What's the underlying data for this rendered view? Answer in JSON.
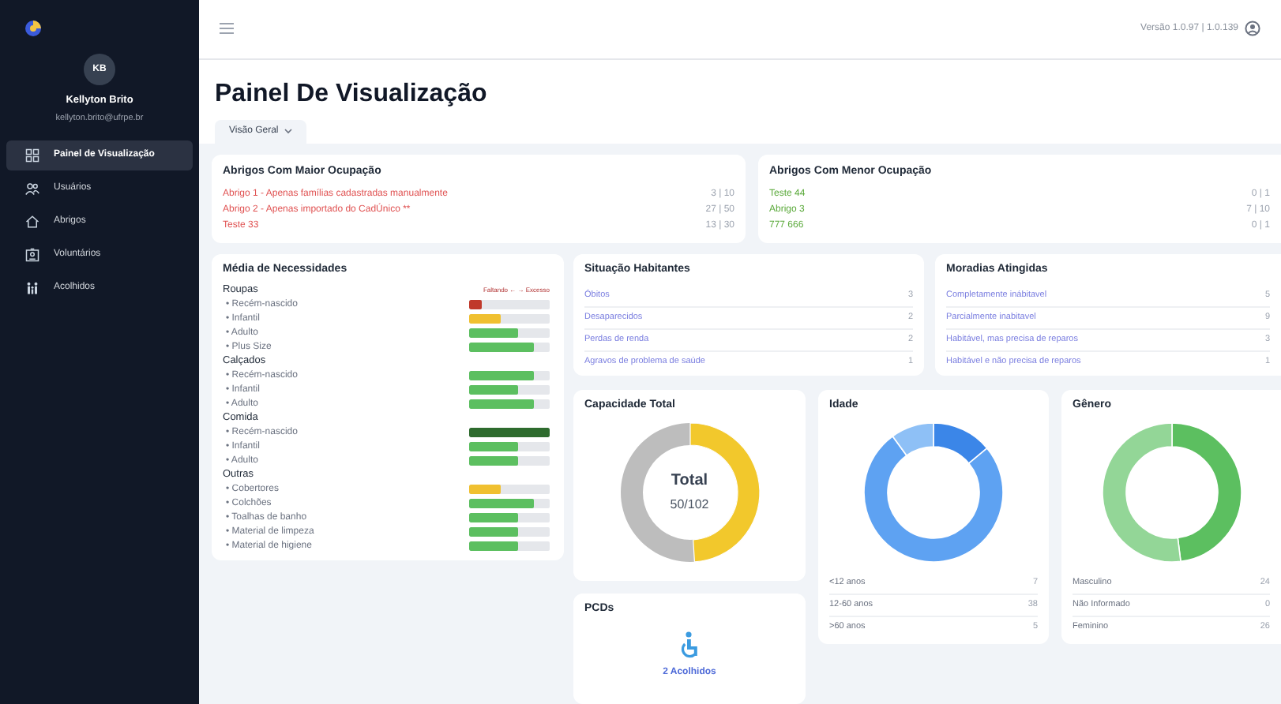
{
  "sidebar": {
    "user": {
      "initials": "KB",
      "name": "Kellyton Brito",
      "email": "kellyton.brito@ufrpe.br"
    },
    "items": [
      {
        "label": "Painel de Visualização",
        "selected": true
      },
      {
        "label": "Usuários",
        "selected": false
      },
      {
        "label": "Abrigos",
        "selected": false
      },
      {
        "label": "Voluntários",
        "selected": false
      },
      {
        "label": "Acolhidos",
        "selected": false
      }
    ]
  },
  "top_bar": {
    "version": "Versão 1.0.97 | 1.0.139"
  },
  "page": {
    "title": "Painel De Visualização",
    "view_dropdown": "Visão Geral"
  },
  "most_occupied": {
    "title": "Abrigos Com Maior Ocupação",
    "rows": [
      {
        "name": "Abrigo 1 - Apenas famílias cadastradas manualmente",
        "occupancy": "3 | 10"
      },
      {
        "name": "Abrigo 2 - Apenas importado do CadÚnico **",
        "occupancy": "27 | 50"
      },
      {
        "name": "Teste 33",
        "occupancy": "13 | 30"
      }
    ]
  },
  "least_occupied": {
    "title": "Abrigos Com Menor Ocupação",
    "rows": [
      {
        "name": "Teste 44",
        "occupancy": "0 | 1"
      },
      {
        "name": "Abrigo 3",
        "occupancy": "7 | 10"
      },
      {
        "name": "777 666",
        "occupancy": "0 | 1"
      }
    ]
  },
  "needs": {
    "title": "Média de Necessidades",
    "legend": "Faltando ← → Excesso",
    "groups": [
      {
        "name": "Roupas",
        "items": [
          {
            "label": "• Recém-nascido",
            "level": 0.16,
            "color": "#c0392b"
          },
          {
            "label": "• Infantil",
            "level": 0.4,
            "color": "#f0c030"
          },
          {
            "label": "• Adulto",
            "level": 0.6,
            "color": "#5cbf60"
          },
          {
            "label": "• Plus Size",
            "level": 0.8,
            "color": "#5cbf60"
          }
        ]
      },
      {
        "name": "Calçados",
        "items": [
          {
            "label": "• Recém-nascido",
            "level": 0.8,
            "color": "#5cbf60"
          },
          {
            "label": "• Infantil",
            "level": 0.6,
            "color": "#5cbf60"
          },
          {
            "label": "• Adulto",
            "level": 0.8,
            "color": "#5cbf60"
          }
        ]
      },
      {
        "name": "Comida",
        "items": [
          {
            "label": "• Recém-nascido",
            "level": 1,
            "color": "#2e6b2e"
          },
          {
            "label": "• Infantil",
            "level": 0.6,
            "color": "#5cbf60"
          },
          {
            "label": "• Adulto",
            "level": 0.6,
            "color": "#5cbf60"
          }
        ]
      },
      {
        "name": "Outras",
        "items": [
          {
            "label": "• Cobertores",
            "level": 0.4,
            "color": "#f0c030"
          },
          {
            "label": "• Colchões",
            "level": 0.8,
            "color": "#5cbf60"
          },
          {
            "label": "• Toalhas de banho",
            "level": 0.6,
            "color": "#5cbf60"
          },
          {
            "label": "• Material de limpeza",
            "level": 0.6,
            "color": "#5cbf60"
          },
          {
            "label": "• Material de higiene",
            "level": 0.6,
            "color": "#5cbf60"
          }
        ]
      }
    ]
  },
  "residents": {
    "title": "Situação Habitantes",
    "rows": [
      {
        "label": "Óbitos",
        "count": "3"
      },
      {
        "label": "Desaparecidos",
        "count": "2"
      },
      {
        "label": "Perdas de renda",
        "count": "2"
      },
      {
        "label": "Agravos de problema de saúde",
        "count": "1"
      }
    ]
  },
  "homes": {
    "title": "Moradias Atingidas",
    "rows": [
      {
        "label": "Completamente inábitavel",
        "count": "5"
      },
      {
        "label": "Parcialmente inabitavel",
        "count": "9"
      },
      {
        "label": "Habitável, mas precisa de reparos",
        "count": "3"
      },
      {
        "label": "Habitável e não precisa de reparos",
        "count": "1"
      }
    ]
  },
  "capacity": {
    "title": "Capacidade Total",
    "center_label": "Total",
    "center_value": "50/102"
  },
  "age": {
    "title": "Idade",
    "rows": [
      {
        "label": "<12 anos",
        "count": "7"
      },
      {
        "label": "12-60 anos",
        "count": "38"
      },
      {
        "label": ">60 anos",
        "count": "5"
      }
    ]
  },
  "gender": {
    "title": "Gênero",
    "rows": [
      {
        "label": "Masculino",
        "count": "24"
      },
      {
        "label": "Não Informado",
        "count": "0"
      },
      {
        "label": "Feminino",
        "count": "26"
      }
    ]
  },
  "pcds": {
    "title": "PCDs",
    "count_label": "2 Acolhidos"
  }
}
